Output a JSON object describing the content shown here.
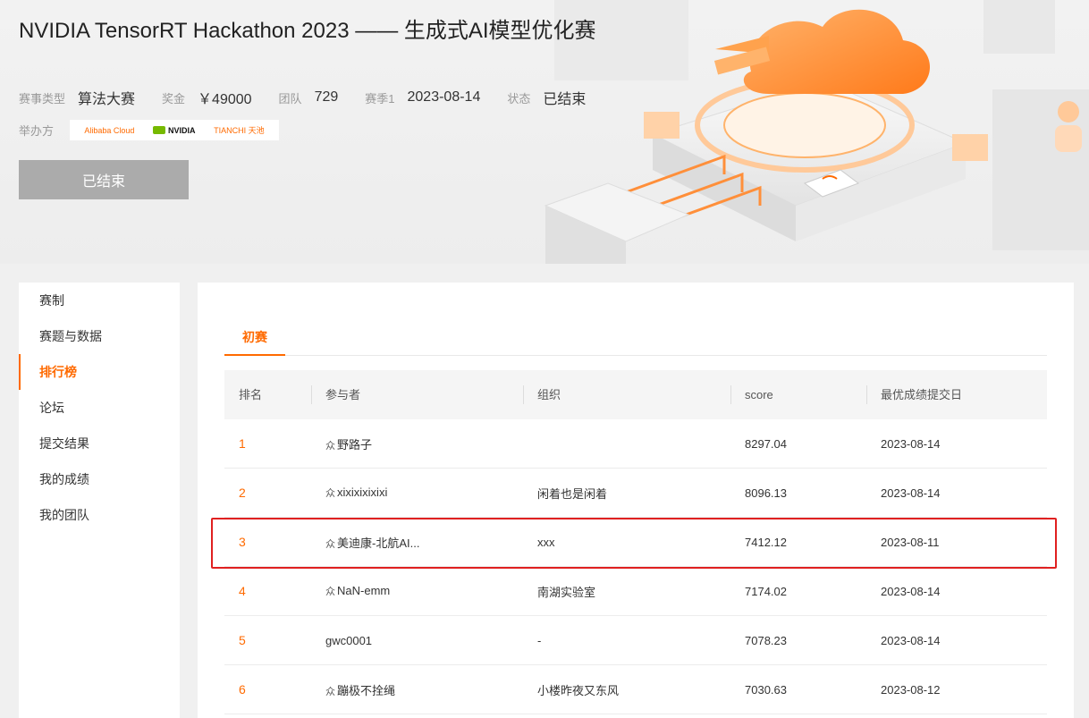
{
  "header": {
    "title": "NVIDIA TensorRT Hackathon 2023 —— 生成式AI模型优化赛",
    "meta": [
      {
        "key": "赛事类型",
        "value": "算法大赛"
      },
      {
        "key": "奖金",
        "value": "￥49000"
      },
      {
        "key": "团队",
        "value": "729"
      },
      {
        "key": "赛季1",
        "value": "2023-08-14"
      },
      {
        "key": "状态",
        "value": "已结束"
      }
    ],
    "organizer_label": "举办方",
    "organizers": [
      "Alibaba Cloud",
      "NVIDIA",
      "TIANCHI 天池"
    ],
    "status_button": "已结束"
  },
  "sidebar": {
    "items": [
      {
        "label": "赛制"
      },
      {
        "label": "赛题与数据"
      },
      {
        "label": "排行榜"
      },
      {
        "label": "论坛"
      },
      {
        "label": "提交结果"
      },
      {
        "label": "我的成绩"
      },
      {
        "label": "我的团队"
      }
    ],
    "active": "排行榜"
  },
  "main": {
    "tab": "初赛",
    "columns": [
      "排名",
      "参与者",
      "组织",
      "score",
      "最优成绩提交日"
    ],
    "team_icon": "people-icon",
    "rows": [
      {
        "rank": "1",
        "team": true,
        "name": "野路子",
        "org": "",
        "score": "8297.04",
        "date": "2023-08-14"
      },
      {
        "rank": "2",
        "team": true,
        "name": "xixixixixixi",
        "org": "闲着也是闲着",
        "score": "8096.13",
        "date": "2023-08-14"
      },
      {
        "rank": "3",
        "team": true,
        "name": "美迪康-北航AI...",
        "org": "xxx",
        "score": "7412.12",
        "date": "2023-08-11"
      },
      {
        "rank": "4",
        "team": true,
        "name": "NaN-emm",
        "org": "南湖实验室",
        "score": "7174.02",
        "date": "2023-08-14"
      },
      {
        "rank": "5",
        "team": false,
        "name": "gwc0001",
        "org": "-",
        "score": "7078.23",
        "date": "2023-08-14"
      },
      {
        "rank": "6",
        "team": true,
        "name": "蹦极不拴绳",
        "org": "小楼昨夜又东风",
        "score": "7030.63",
        "date": "2023-08-12"
      }
    ]
  },
  "colors": {
    "accent": "#ff6a00",
    "highlight": "#e02020",
    "button_disabled": "#ababab"
  }
}
